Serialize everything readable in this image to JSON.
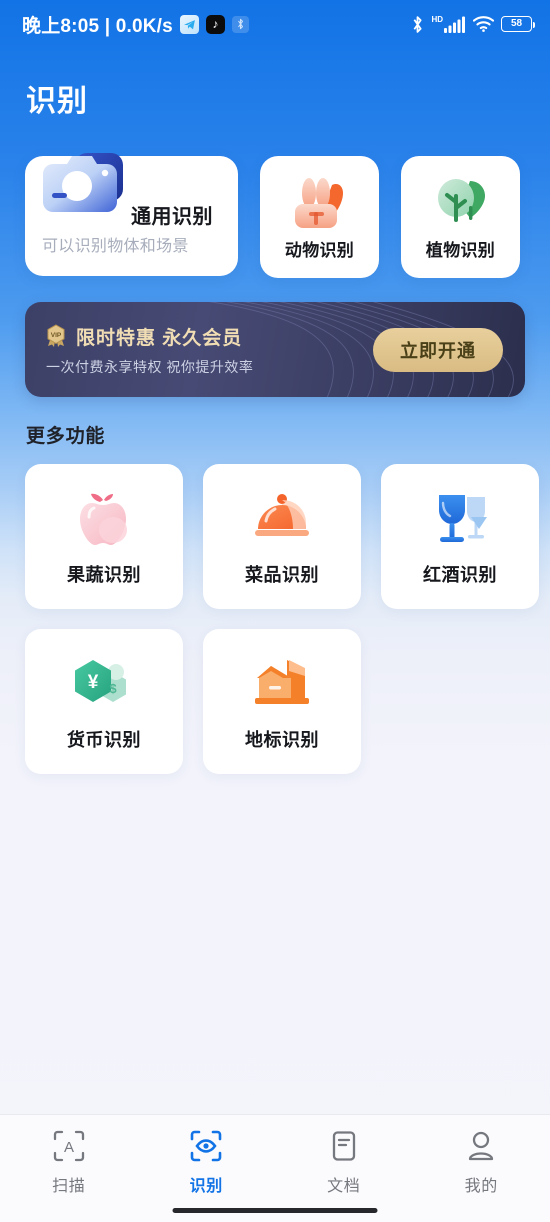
{
  "status_bar": {
    "clock": "晚上8:05",
    "separator": "|",
    "network_speed": "0.0K/s",
    "app_icons": [
      "telegram-icon",
      "tiktok-icon",
      "bluetooth-muted-icon"
    ],
    "tiktok_glyph": "♪",
    "hd_label": "HD",
    "signal_bars": 5,
    "wifi": "wifi-icon",
    "bluetooth": "bluetooth-icon",
    "battery_percent": "58"
  },
  "header": {
    "title": "识别"
  },
  "top_cards": {
    "main": {
      "title": "通用识别",
      "subtitle": "可以识别物体和场景",
      "icon": "camera-icon"
    },
    "small": [
      {
        "label": "动物识别",
        "icon": "rabbit-icon"
      },
      {
        "label": "植物识别",
        "icon": "tree-icon"
      }
    ]
  },
  "vip_banner": {
    "badge": "vip-medal-icon",
    "title": "限时特惠 永久会员",
    "subtitle": "一次付费永享特权 祝你提升效率",
    "button_label": "立即开通",
    "bg_color": "#3f4268",
    "gold_color": "#e0c28e"
  },
  "more_section": {
    "title": "更多功能",
    "items": [
      {
        "label": "果蔬识别",
        "icon": "apple-icon"
      },
      {
        "label": "菜品识别",
        "icon": "food-dome-icon"
      },
      {
        "label": "红酒识别",
        "icon": "wine-glass-icon"
      },
      {
        "label": "货币识别",
        "icon": "currency-hexagon-icon"
      },
      {
        "label": "地标识别",
        "icon": "landmark-building-icon"
      }
    ]
  },
  "tabbar": {
    "active_color": "#1273e6",
    "inactive_color": "#76787f",
    "tabs": [
      {
        "label": "扫描",
        "icon": "scan-frame-a-icon",
        "active": false
      },
      {
        "label": "识别",
        "icon": "scan-eye-icon",
        "active": true
      },
      {
        "label": "文档",
        "icon": "document-icon",
        "active": false
      },
      {
        "label": "我的",
        "icon": "person-icon",
        "active": false
      }
    ]
  }
}
